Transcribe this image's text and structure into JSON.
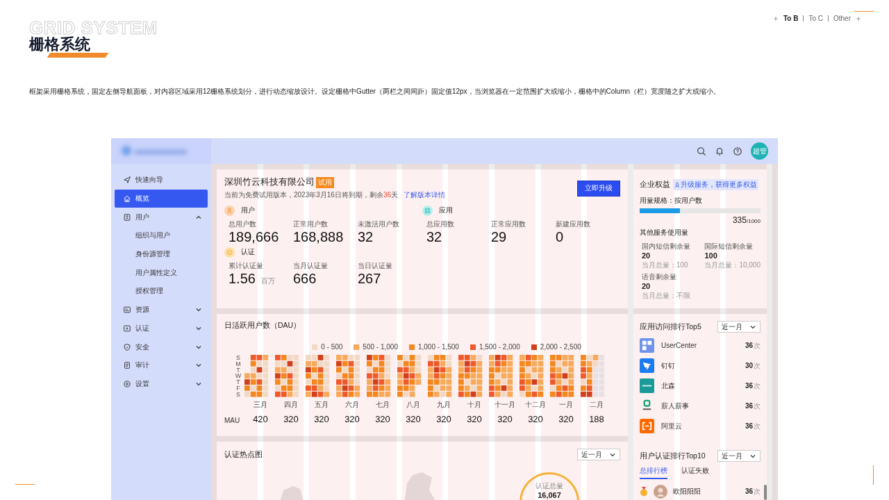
{
  "header": {
    "watermark_title": "GRID SYSTEM",
    "title": "栅格系统",
    "nav": [
      {
        "label": "To B",
        "selected": true
      },
      {
        "label": "To C",
        "selected": false
      },
      {
        "label": "Other",
        "selected": false
      }
    ],
    "description": "框架采用栅格系统，固定左侧导航面板，对内容区域采用12栅格系统划分，进行动态缩放设计。设定栅格中Gutter（两栏之间间距）固定值12px，当浏览器在一定范围扩大或缩小，栅格中的Column（栏）宽度随之扩大或缩小。"
  },
  "topbar": {
    "avatar": "超管"
  },
  "sidebar": {
    "items": [
      {
        "label": "快速向导",
        "selected": false
      },
      {
        "label": "概览",
        "selected": true
      },
      {
        "label": "用户",
        "selected": false,
        "expanded": true,
        "children": [
          {
            "label": "组织与用户",
            "selected": false
          },
          {
            "label": "身份源管理",
            "selected": false
          },
          {
            "label": "用户属性定义",
            "selected": false
          },
          {
            "label": "授权管理",
            "selected": false
          }
        ]
      },
      {
        "label": "资源",
        "selected": false,
        "expanded": false
      },
      {
        "label": "认证",
        "selected": false,
        "expanded": false
      },
      {
        "label": "安全",
        "selected": false,
        "expanded": false
      },
      {
        "label": "审计",
        "selected": false,
        "expanded": false
      },
      {
        "label": "设置",
        "selected": false,
        "expanded": false
      }
    ]
  },
  "company": {
    "name": "深圳竹云科技有限公司",
    "badge": "试用",
    "notice": "当前为免费试用版本，2023年3月16日将到期，剩余",
    "days": "36",
    "days_unit": "天",
    "link": "了解版本详情",
    "button": "立即升级"
  },
  "stat_sections": [
    {
      "kind": "users",
      "title": "用户",
      "stats": [
        {
          "label": "总用户数",
          "value": "189,666"
        },
        {
          "label": "正常用户数",
          "value": "168,888"
        },
        {
          "label": "未激活用户数",
          "value": "32"
        }
      ]
    },
    {
      "kind": "apps",
      "title": "应用",
      "stats": [
        {
          "label": "总应用数",
          "value": "32"
        },
        {
          "label": "正常应用数",
          "value": "29"
        },
        {
          "label": "新建应用数",
          "value": "0"
        }
      ]
    },
    {
      "kind": "auth",
      "title": "认证",
      "stats": [
        {
          "label": "累计认证量",
          "value": "1.56",
          "unit": "百万"
        },
        {
          "label": "当月认证量",
          "value": "666"
        },
        {
          "label": "当日认证量",
          "value": "267"
        }
      ]
    }
  ],
  "dau": {
    "title": "日活跃用户数（DAU）",
    "legend": [
      {
        "label": "0 - 500",
        "color": "#f2d9c6"
      },
      {
        "label": "500 - 1,000",
        "color": "#f8aa5c"
      },
      {
        "label": "1,000 - 1,500",
        "color": "#f5871f"
      },
      {
        "label": "1,500 - 2,000",
        "color": "#f05a2a"
      },
      {
        "label": "2,000 - 2,500",
        "color": "#d1401a"
      }
    ],
    "weekdays": [
      "S",
      "M",
      "T",
      "W",
      "T",
      "F",
      "S"
    ],
    "mau_label": "MAU",
    "months": [
      {
        "name": "三月",
        "mau": "420"
      },
      {
        "name": "四月",
        "mau": "320"
      },
      {
        "name": "五月",
        "mau": "320"
      },
      {
        "name": "六月",
        "mau": "320"
      },
      {
        "name": "七月",
        "mau": "320"
      },
      {
        "name": "八月",
        "mau": "320"
      },
      {
        "name": "九月",
        "mau": "320"
      },
      {
        "name": "十月",
        "mau": "320"
      },
      {
        "name": "十一月",
        "mau": "320"
      },
      {
        "name": "十二月",
        "mau": "320"
      },
      {
        "name": "一月",
        "mau": "320"
      },
      {
        "name": "二月",
        "mau": "188"
      }
    ]
  },
  "auth_map": {
    "title": "认证热点图",
    "range": "近一月",
    "total_label": "认证总量",
    "total": "16,067"
  },
  "benefits": {
    "title": "企业权益",
    "tag": "升级服务，获得更多权益",
    "plan_label": "用量规格：按用户数",
    "level": 0.335,
    "used": "335",
    "quota": "/1000",
    "other_title": "其他服务使用量",
    "services": [
      {
        "label": "国内短信剩余量",
        "value": "20",
        "total": "当月总量：100"
      },
      {
        "label": "国际短信剩余量",
        "value": "100",
        "total": "当月总量：10,000"
      },
      {
        "label": "语音剩余量",
        "value": "20",
        "total": "当月总量：不限"
      }
    ]
  },
  "top_apps": {
    "title": "应用访问排行Top5",
    "range": "近一月",
    "items": [
      {
        "name": "UserCenter",
        "count": "36",
        "unit": "次"
      },
      {
        "name": "钉钉",
        "count": "30",
        "unit": "次"
      },
      {
        "name": "北森",
        "count": "36",
        "unit": "次"
      },
      {
        "name": "薪人薪事",
        "count": "36",
        "unit": "次"
      },
      {
        "name": "阿里云",
        "count": "36",
        "unit": "次"
      }
    ]
  },
  "top_users": {
    "title": "用户认证排行Top10",
    "range": "近一月",
    "tabs": [
      {
        "label": "总排行榜",
        "selected": true
      },
      {
        "label": "认证失败",
        "selected": false
      }
    ],
    "items": [
      {
        "name": "欧阳阳阳",
        "count": "36",
        "unit": "次"
      }
    ]
  }
}
